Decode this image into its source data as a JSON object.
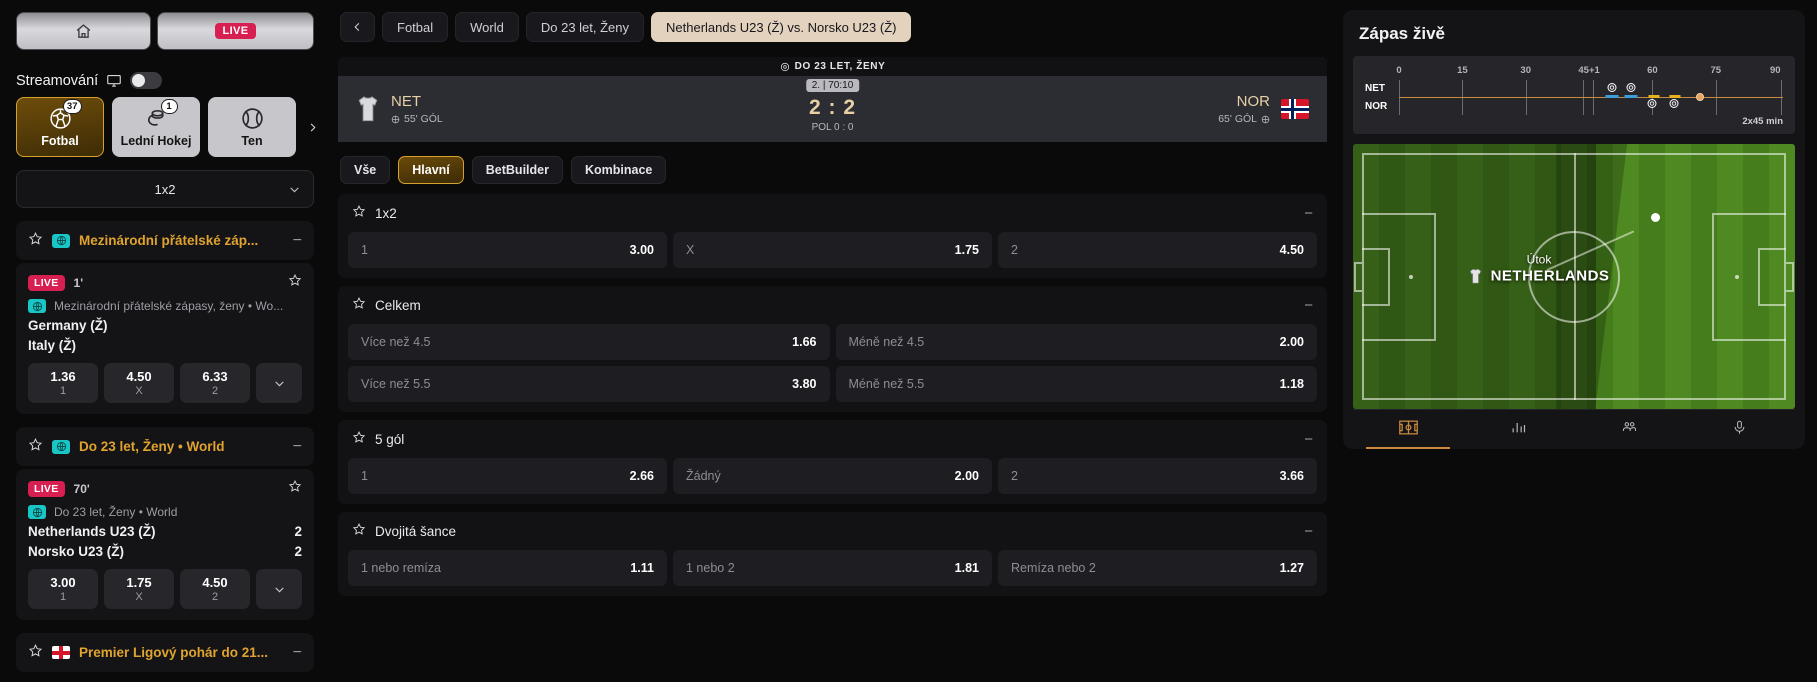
{
  "sidebar": {
    "home_icon": "home-icon",
    "live_label": "LIVE",
    "streaming_label": "Streamování",
    "sports": [
      {
        "name": "Fotbal",
        "count": "37",
        "icon": "football-icon",
        "active": true
      },
      {
        "name": "Lední Hokej",
        "count": "1",
        "icon": "hockey-icon",
        "active": false
      },
      {
        "name": "Ten",
        "count": "",
        "icon": "tennis-icon",
        "active": false
      }
    ],
    "market_select": "1x2",
    "groups": [
      {
        "title": "Mezinárodní přátelské záp...",
        "icon": "globe-icon",
        "events": [
          {
            "live": "LIVE",
            "minute": "1'",
            "league": "Mezinárodní přátelské zápasy, ženy • Wo...",
            "home": "Germany (Ž)",
            "away": "Italy (Ž)",
            "home_score": "",
            "away_score": "",
            "odds": [
              {
                "value": "1.36",
                "key": "1"
              },
              {
                "value": "4.50",
                "key": "X"
              },
              {
                "value": "6.33",
                "key": "2"
              }
            ]
          }
        ]
      },
      {
        "title": "Do 23 let, Ženy • World",
        "icon": "globe-icon",
        "events": [
          {
            "live": "LIVE",
            "minute": "70'",
            "league": "Do 23 let, Ženy • World",
            "home": "Netherlands U23 (Ž)",
            "away": "Norsko U23 (Ž)",
            "home_score": "2",
            "away_score": "2",
            "odds": [
              {
                "value": "3.00",
                "key": "1"
              },
              {
                "value": "1.75",
                "key": "X"
              },
              {
                "value": "4.50",
                "key": "2"
              }
            ]
          }
        ]
      },
      {
        "title": "Premier Ligový pohár do 21...",
        "icon": "flag-england-icon",
        "events": []
      }
    ]
  },
  "breadcrumbs": [
    {
      "label": "Fotbal",
      "active": false
    },
    {
      "label": "World",
      "active": false
    },
    {
      "label": "Do 23 let, Ženy",
      "active": false
    },
    {
      "label": "Netherlands U23 (Ž) vs. Norsko U23 (Ž)",
      "active": true
    }
  ],
  "match": {
    "competition": "DO 23 LET, ŽENY",
    "period_chip": "2. | 70:10",
    "score": "2 : 2",
    "half_score": "POL 0 : 0",
    "home": {
      "code": "NET",
      "goal_info": "55' GÓL"
    },
    "away": {
      "code": "NOR",
      "goal_info": "65' GÓL"
    }
  },
  "market_tabs": [
    {
      "label": "Vše",
      "active": false
    },
    {
      "label": "Hlavní",
      "active": true
    },
    {
      "label": "BetBuilder",
      "active": false
    },
    {
      "label": "Kombinace",
      "active": false
    }
  ],
  "markets": [
    {
      "name": "1x2",
      "columns": 3,
      "selections": [
        {
          "label": "1",
          "odds": "3.00"
        },
        {
          "label": "X",
          "odds": "1.75"
        },
        {
          "label": "2",
          "odds": "4.50"
        }
      ]
    },
    {
      "name": "Celkem",
      "columns": 2,
      "selections": [
        {
          "label": "Více než 4.5",
          "odds": "1.66"
        },
        {
          "label": "Méně než 4.5",
          "odds": "2.00"
        },
        {
          "label": "Více než 5.5",
          "odds": "3.80"
        },
        {
          "label": "Méně než 5.5",
          "odds": "1.18"
        }
      ]
    },
    {
      "name": "5 gól",
      "columns": 3,
      "selections": [
        {
          "label": "1",
          "odds": "2.66"
        },
        {
          "label": "Žádný",
          "odds": "2.00"
        },
        {
          "label": "2",
          "odds": "3.66"
        }
      ]
    },
    {
      "name": "Dvojitá šance",
      "columns": 3,
      "selections": [
        {
          "label": "1 nebo remíza",
          "odds": "1.11"
        },
        {
          "label": "1 nebo 2",
          "odds": "1.81"
        },
        {
          "label": "Remíza nebo 2",
          "odds": "1.27"
        }
      ]
    }
  ],
  "live_panel": {
    "title": "Zápas živě",
    "timeline": {
      "ticks": [
        "0",
        "15",
        "30",
        "45+1",
        "60",
        "75",
        "90"
      ],
      "tick_positions": [
        0,
        16.5,
        33,
        49.5,
        66,
        82.5,
        99
      ],
      "home_label": "NET",
      "away_label": "NOR",
      "format": "2x45 min",
      "home_events": [
        {
          "type": "ball-icon",
          "pos": 55.5
        },
        {
          "type": "ball-icon",
          "pos": 60.5
        }
      ],
      "away_events": [
        {
          "type": "ball-icon",
          "pos": 66.0
        },
        {
          "type": "ball-icon",
          "pos": 71.5
        }
      ],
      "home_bars": [
        55.5,
        60.5
      ],
      "away_bars": [
        66.0,
        71.5
      ],
      "ball_position": 78.5
    },
    "pitch": {
      "attack_label": "Útok",
      "attack_team": "NETHERLANDS"
    },
    "tabs": [
      {
        "icon": "pitch-icon",
        "active": true
      },
      {
        "icon": "stats-bar-icon",
        "active": false
      },
      {
        "icon": "lineup-icon",
        "active": false
      },
      {
        "icon": "commentary-mic-icon",
        "active": false
      }
    ]
  }
}
